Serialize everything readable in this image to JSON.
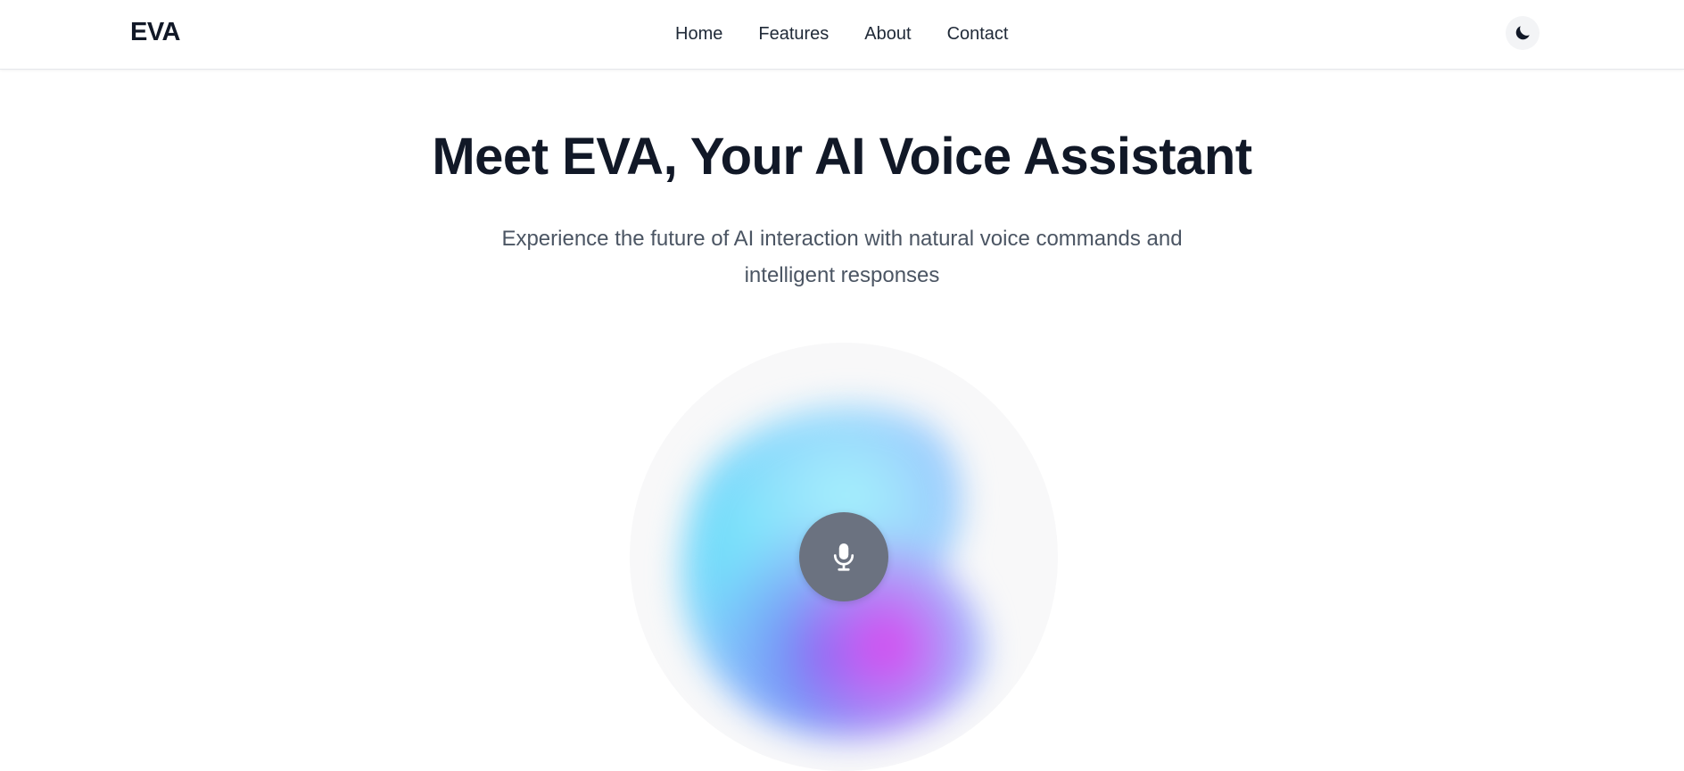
{
  "nav": {
    "logo": "EVA",
    "links": [
      "Home",
      "Features",
      "About",
      "Contact"
    ],
    "theme_toggle_icon": "moon-icon"
  },
  "hero": {
    "title": "Meet EVA, Your AI Voice Assistant",
    "subtitle": "Experience the future of AI interaction with natural voice commands and intelligent responses"
  },
  "voice_orb": {
    "button_icon": "microphone-icon",
    "colors": [
      "#67e8f9",
      "#a5f3fc",
      "#818cf8",
      "#6366f1",
      "#d946ef",
      "#93c5fd"
    ]
  },
  "colors": {
    "text_primary": "#111827",
    "text_secondary": "#4b5563",
    "mic_button": "#6b7280"
  }
}
